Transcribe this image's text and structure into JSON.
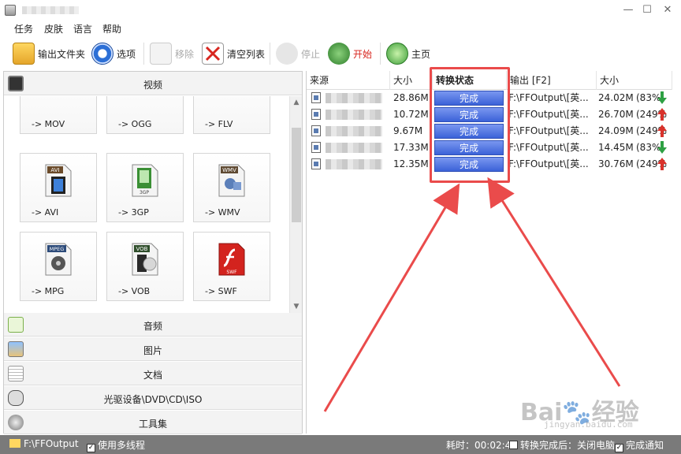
{
  "menu": [
    "任务",
    "皮肤",
    "语言",
    "帮助"
  ],
  "toolbar": {
    "output_folder": "输出文件夹",
    "options": "选项",
    "remove": "移除",
    "clear_list": "清空列表",
    "stop": "停止",
    "start": "开始",
    "home": "主页"
  },
  "categories": {
    "video": "视频",
    "audio": "音频",
    "picture": "图片",
    "document": "文档",
    "rom": "光驱设备\\DVD\\CD\\ISO",
    "tools": "工具集"
  },
  "tiles": [
    {
      "label": "-> MOV",
      "badge": ""
    },
    {
      "label": "-> OGG",
      "badge": ""
    },
    {
      "label": "-> FLV",
      "badge": ""
    },
    {
      "label": "-> AVI",
      "badge": "AVI"
    },
    {
      "label": "-> 3GP",
      "badge": "3GP"
    },
    {
      "label": "-> WMV",
      "badge": "WMV"
    },
    {
      "label": "-> MPG",
      "badge": "MPEG"
    },
    {
      "label": "-> VOB",
      "badge": "VOB"
    },
    {
      "label": "-> SWF",
      "badge": "SWF"
    }
  ],
  "table": {
    "headers": [
      "来源",
      "大小",
      "转换状态",
      "输出 [F2]",
      "大小"
    ],
    "rows": [
      {
        "size": "28.86M",
        "status": "完成",
        "output": "F:\\FFOutput\\[英...",
        "out_size": "24.02M",
        "pct": "(83%)",
        "trend": "down"
      },
      {
        "size": "10.72M",
        "status": "完成",
        "output": "F:\\FFOutput\\[英...",
        "out_size": "26.70M",
        "pct": "(249%)",
        "trend": "up"
      },
      {
        "size": "9.67M",
        "status": "完成",
        "output": "F:\\FFOutput\\[英...",
        "out_size": "24.09M",
        "pct": "(249%)",
        "trend": "up"
      },
      {
        "size": "17.33M",
        "status": "完成",
        "output": "F:\\FFOutput\\[英...",
        "out_size": "14.45M",
        "pct": "(83%)",
        "trend": "down"
      },
      {
        "size": "12.35M",
        "status": "完成",
        "output": "F:\\FFOutput\\[英...",
        "out_size": "30.76M",
        "pct": "(249%)",
        "trend": "up"
      }
    ]
  },
  "statusbar": {
    "output_path": "F:\\FFOutput",
    "multithread": "使用多线程",
    "elapsed": "耗时：00:02:44",
    "after_done": "转换完成后：关闭电脑",
    "notify": "完成通知"
  },
  "watermark": {
    "main": "Bai🐾经验",
    "sub": "jingyan.baidu.com"
  },
  "colors": {
    "status_fill": "#3b62d8",
    "highlight": "#ea4b4b",
    "up": "#d9322b",
    "down": "#2ea043"
  }
}
